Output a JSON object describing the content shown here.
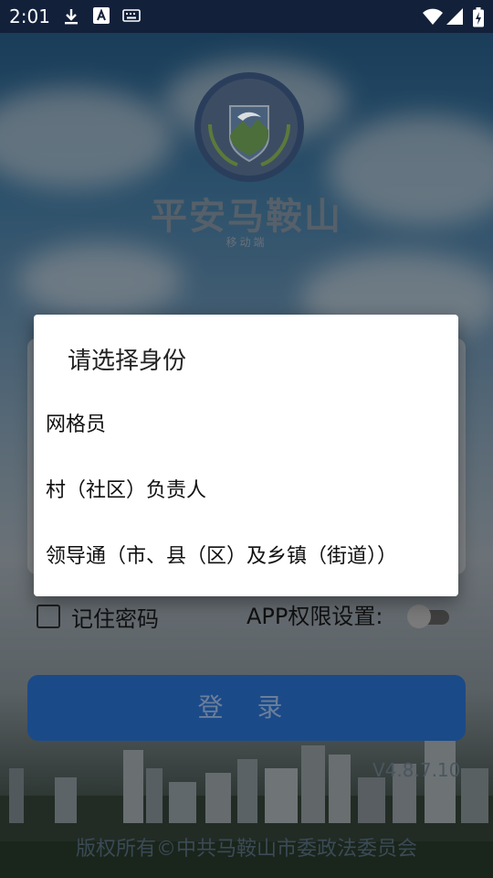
{
  "status_bar": {
    "time": "2:01",
    "icons": [
      "download-icon",
      "a-notification-icon",
      "keyboard-icon",
      "wifi-icon",
      "signal-icon",
      "battery-icon"
    ]
  },
  "app": {
    "emblem_text": "平安马鞍山",
    "title": "平安马鞍山",
    "subtitle": "移动端"
  },
  "login": {
    "remember_label": "记住密码",
    "permission_label": "APP权限设置:",
    "permission_enabled": false,
    "login_label": "登 录",
    "version": "V4.8.7.10",
    "copyright": "版权所有©中共马鞍山市委政法委员会"
  },
  "dialog": {
    "title": "请选择身份",
    "options": [
      "网格员",
      "村（社区）负责人",
      "领导通（市、县（区）及乡镇（街道））"
    ]
  },
  "colors": {
    "status_bar": "#12203a",
    "login_button": "#1b4a88",
    "dialog_bg": "#ffffff"
  }
}
